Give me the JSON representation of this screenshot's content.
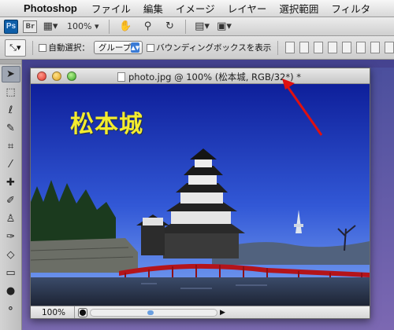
{
  "menubar": {
    "app": "Photoshop",
    "items": [
      "ファイル",
      "編集",
      "イメージ",
      "レイヤー",
      "選択範囲",
      "フィルタ"
    ]
  },
  "appbar": {
    "ps_label": "Ps",
    "br_label": "Br",
    "zoom": "100%"
  },
  "options": {
    "auto_select_label": "自動選択：",
    "group_value": "グループ",
    "bounding_box_label": "バウンディングボックスを表示"
  },
  "document": {
    "title": "photo.jpg @ 100% (松本城, RGB/32*) *",
    "overlay_text": "松本城",
    "zoom": "100%"
  },
  "colors": {
    "sky_top": "#0e1f9a",
    "sky_bottom": "#5c8ff0",
    "overlay_text": "#f4ec2e",
    "annotation": "#e01010"
  }
}
